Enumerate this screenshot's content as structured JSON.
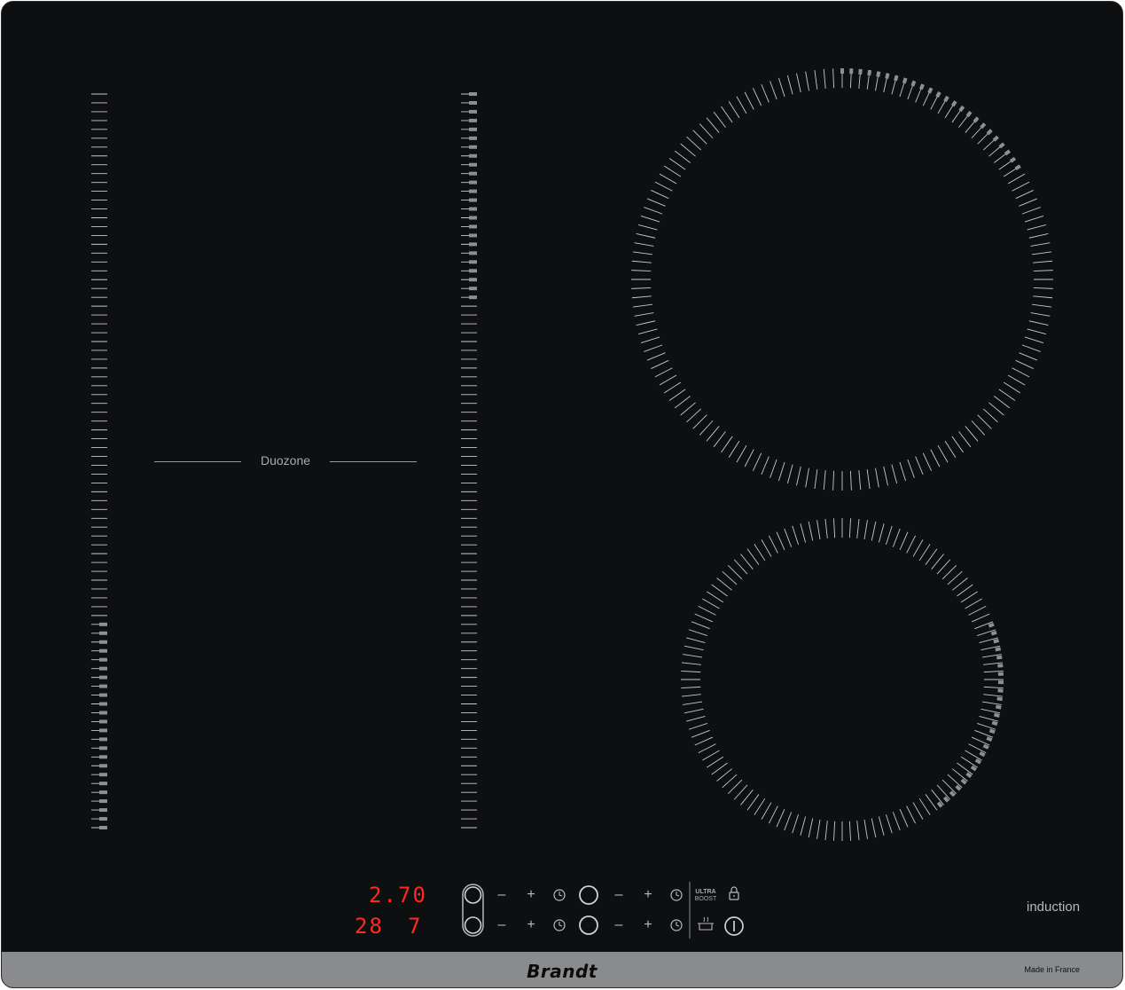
{
  "feature_label": "Duozone",
  "badge": "induction",
  "brand": "Brandt",
  "origin": "Made in France",
  "displays": {
    "top_left": "2.",
    "top_right": "70",
    "bottom_left": "28",
    "bottom_right": "7"
  },
  "controls": {
    "minus": "–",
    "plus": "+",
    "boost_line1": "ULTRA",
    "boost_line2": "BOOST"
  },
  "zone_levels": {
    "left_strip_lit_fraction": 0.29,
    "middle_strip_lit_fraction": 0.29,
    "top_ring_lit_fraction": 0.17,
    "bottom_ring_lit_fraction": 0.21
  },
  "colors": {
    "glass": "#0e0f11",
    "tick": "#c8c9cb",
    "lit_tick": "#8e8f91",
    "display_red": "#ff2a1a",
    "strip": "#8a8b8d"
  },
  "icons": [
    "timer-icon",
    "lock-icon",
    "power-icon",
    "pot-icon",
    "zone-circle-icon",
    "bridge-zone-icon"
  ]
}
